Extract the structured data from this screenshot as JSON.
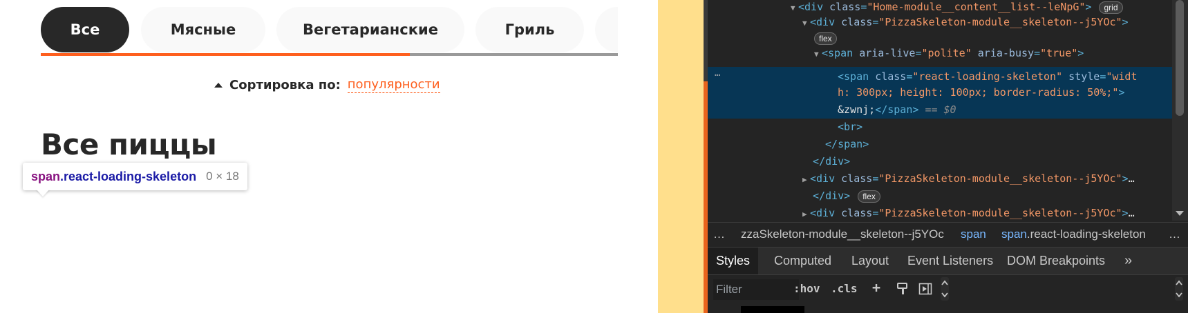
{
  "page": {
    "categories": [
      {
        "label": "Все",
        "active": true
      },
      {
        "label": "Мясные",
        "active": false
      },
      {
        "label": "Вегетарианские",
        "active": false
      },
      {
        "label": "Гриль",
        "active": false
      }
    ],
    "sort": {
      "label": "Сортировка по:",
      "value": "популярности"
    },
    "title": "Все пиццы",
    "scroll_progress": 0.64
  },
  "tooltip": {
    "tag": "span",
    "class_name": ".react-loading-skeleton",
    "size": "0 × 18"
  },
  "devtools": {
    "dom": {
      "l1": {
        "attr": "class",
        "value": "\"Home-module__content__list--leNpG\"",
        "badge": "grid"
      },
      "l2": {
        "attr": "class",
        "value": "\"PizzaSkeleton-module__skeleton--j5YOc\""
      },
      "l2_badge": "flex",
      "l3": {
        "attr1": "aria-live",
        "value1": "\"polite\"",
        "attr2": "aria-busy",
        "value2": "\"true\""
      },
      "l4": {
        "attr1": "class",
        "value1": "\"react-loading-skeleton\"",
        "attr2": "style",
        "value2a": "\"widt",
        "value2b": "h: 300px; height: 100px; border-radius: 50%;\""
      },
      "l6": {
        "text": "&zwnj;",
        "eq": "== $0"
      },
      "l10": {
        "attr": "class",
        "value": "\"PizzaSkeleton-module__skeleton--j5YOc\"",
        "ellipsis": "…"
      },
      "l11_badge": "flex",
      "l12": {
        "attr": "class",
        "value": "\"PizzaSkeleton-module__skeleton--j5YOc\"",
        "ellipsis": "…"
      },
      "tags": {
        "div": "div",
        "span": "span",
        "br": "br"
      },
      "dots": "…"
    },
    "breadcrumb": {
      "lead": "…",
      "items": [
        "zzaSkeleton-module__skeleton--j5YOc",
        "span",
        "span"
      ],
      "last_class": ".react-loading-skeleton",
      "more": "…"
    },
    "tabs": [
      "Styles",
      "Computed",
      "Layout",
      "Event Listeners",
      "DOM Breakpoints"
    ],
    "tabs_more": "»",
    "filter": {
      "placeholder": "Filter",
      "hov": ":hov",
      "cls": ".cls",
      "plus": "+"
    }
  },
  "colors": {
    "accent": "#fe5f1e",
    "dark": "#282828",
    "devtools_bg": "#242424",
    "selection": "#073655",
    "yellow": "#ffdf8c"
  }
}
